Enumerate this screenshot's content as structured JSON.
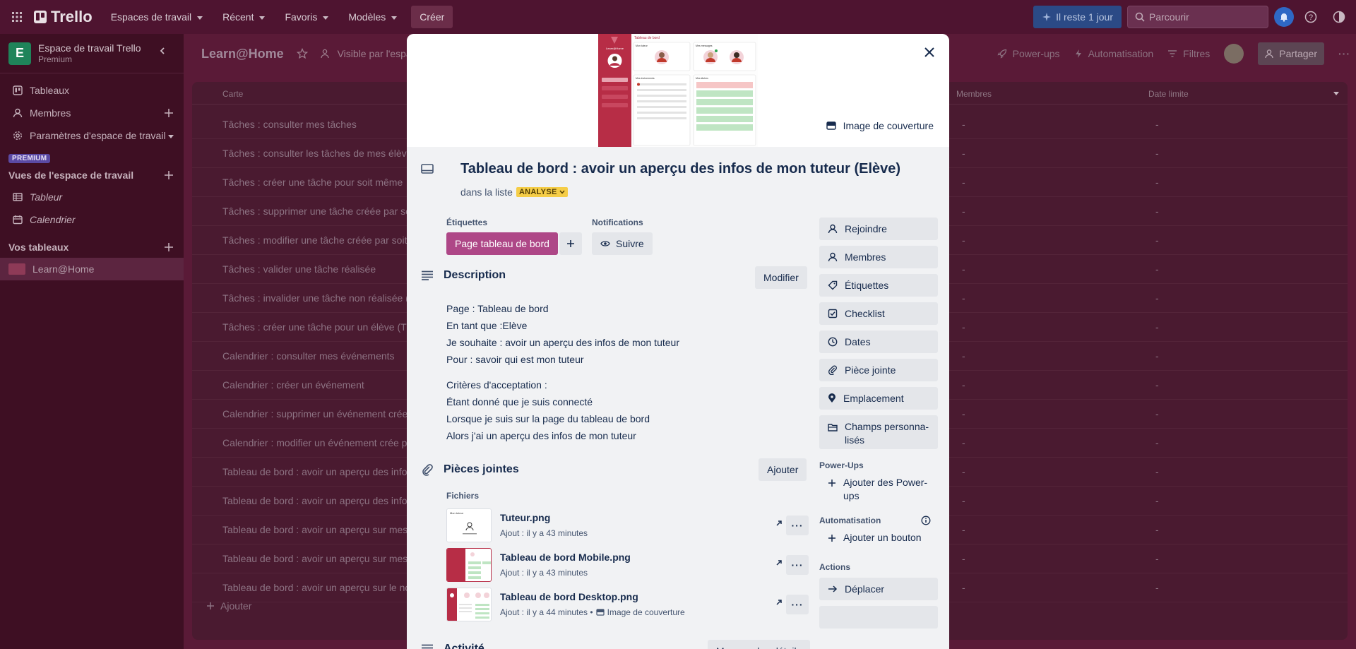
{
  "topbar": {
    "app_name": "Trello",
    "nav": [
      "Espaces de travail",
      "Récent",
      "Favoris",
      "Modèles"
    ],
    "create_label": "Créer",
    "trial_label": "Il reste 1 jour",
    "search_placeholder": "Parcourir"
  },
  "sidebar": {
    "workspace_initial": "E",
    "workspace_name": "Espace de travail Trello",
    "workspace_plan": "Premium",
    "items": [
      "Tableaux",
      "Membres",
      "Paramètres d'espace de travail"
    ],
    "premium_tag": "PREMIUM",
    "views_title": "Vues de l'espace de travail",
    "views": [
      "Tableur",
      "Calendrier"
    ],
    "boards_title": "Vos tableaux",
    "boards": [
      "Learn@Home"
    ]
  },
  "board": {
    "title": "Learn@Home",
    "visibility": "Visible par l'espa",
    "powerups": "Power-ups",
    "automation": "Automatisation",
    "filters": "Filtres",
    "share": "Partager",
    "columns": {
      "card": "Carte",
      "members": "Membres",
      "due": "Date limite"
    },
    "rows": [
      "Tâches : consulter mes tâches",
      "Tâches : consulter les tâches de mes élèves",
      "Tâches : créer une tâche pour soit même",
      "Tâches : supprimer une tâche créée par soit",
      "Tâches : modifier une tâche créée par soit n",
      "Tâches : valider une tâche réalisée",
      "Tâches : invalider une tâche non réalisée (ou",
      "Tâches : créer une tâche pour un élève (Tut",
      "Calendrier : consulter mes événements",
      "Calendrier : créer un événement",
      "Calendrier : supprimer un événement crée",
      "Calendrier : modifier un événement crée pa",
      "Tableau de bord : avoir un aperçu des infos",
      "Tableau de bord : avoir un aperçu des infos",
      "Tableau de bord : avoir un aperçu sur mes",
      "Tableau de bord : avoir un aperçu sur mes",
      "Tableau de bord : avoir un aperçu sur le no"
    ],
    "empty_cell": "-",
    "add_label": "Ajouter"
  },
  "modal": {
    "cover_button": "Image de couverture",
    "cover_preview": {
      "heading": "Tableau de bord",
      "brand": "Learn@Home",
      "tutor_label": "Mon tuteur",
      "messages_label": "Mes messages",
      "events_label": "Mes événements",
      "tasks_label": "Mes tâches"
    },
    "title": "Tableau de bord : avoir un aperçu des infos de mon tuteur (Elève)",
    "in_list_prefix": "dans la liste",
    "list_name": "ANALYSE",
    "labels_title": "Étiquettes",
    "label_chip": "Page tableau de bord",
    "notifications_title": "Notifications",
    "follow_label": "Suivre",
    "description_title": "Description",
    "edit_label": "Modifier",
    "description": {
      "l1": "Page : Tableau de bord",
      "l2": "En tant que :Elève",
      "l3": "Je souhaite : avoir un aperçu des infos de mon tuteur",
      "l4": "Pour : savoir qui est mon tuteur",
      "l5": "Critères d'acceptation :",
      "l6": "Étant donné que je suis connecté",
      "l7": "Lorsque je suis sur la page du tableau de bord",
      "l8": "Alors j'ai un aperçu des infos de  mon tuteur"
    },
    "attachments_title": "Pièces jointes",
    "add_label": "Ajouter",
    "files_title": "Fichiers",
    "files": [
      {
        "name": "Tuteur.png",
        "meta": "Ajout : il y a 43 minutes",
        "extra": "",
        "thumb_text": "Mon tuteur"
      },
      {
        "name": "Tableau de bord Mobile.png",
        "meta": "Ajout : il y a 43 minutes",
        "extra": ""
      },
      {
        "name": "Tableau de bord Desktop.png",
        "meta": "Ajout : il y a 44 minutes •",
        "extra": "Image de couverture"
      }
    ],
    "activity_title": "Activité",
    "details_label": "Masquer les détails",
    "side": {
      "buttons": [
        "Rejoindre",
        "Membres",
        "Étiquettes",
        "Checklist",
        "Dates",
        "Pièce jointe",
        "Emplacement"
      ],
      "custom_fields_1": "Champs personna-",
      "custom_fields_2": "lisés",
      "powerups_title": "Power-Ups",
      "add_powerups_1": "Ajouter des Power-",
      "add_powerups_2": "ups",
      "automation_title": "Automatisation",
      "add_button": "Ajouter un bouton",
      "actions_title": "Actions",
      "move": "Déplacer"
    }
  },
  "colors": {
    "label_chip": "#ae4787",
    "list_badge": "#f5cd47",
    "board_bg": "#5a1a37",
    "trial": "#2b4a86"
  }
}
